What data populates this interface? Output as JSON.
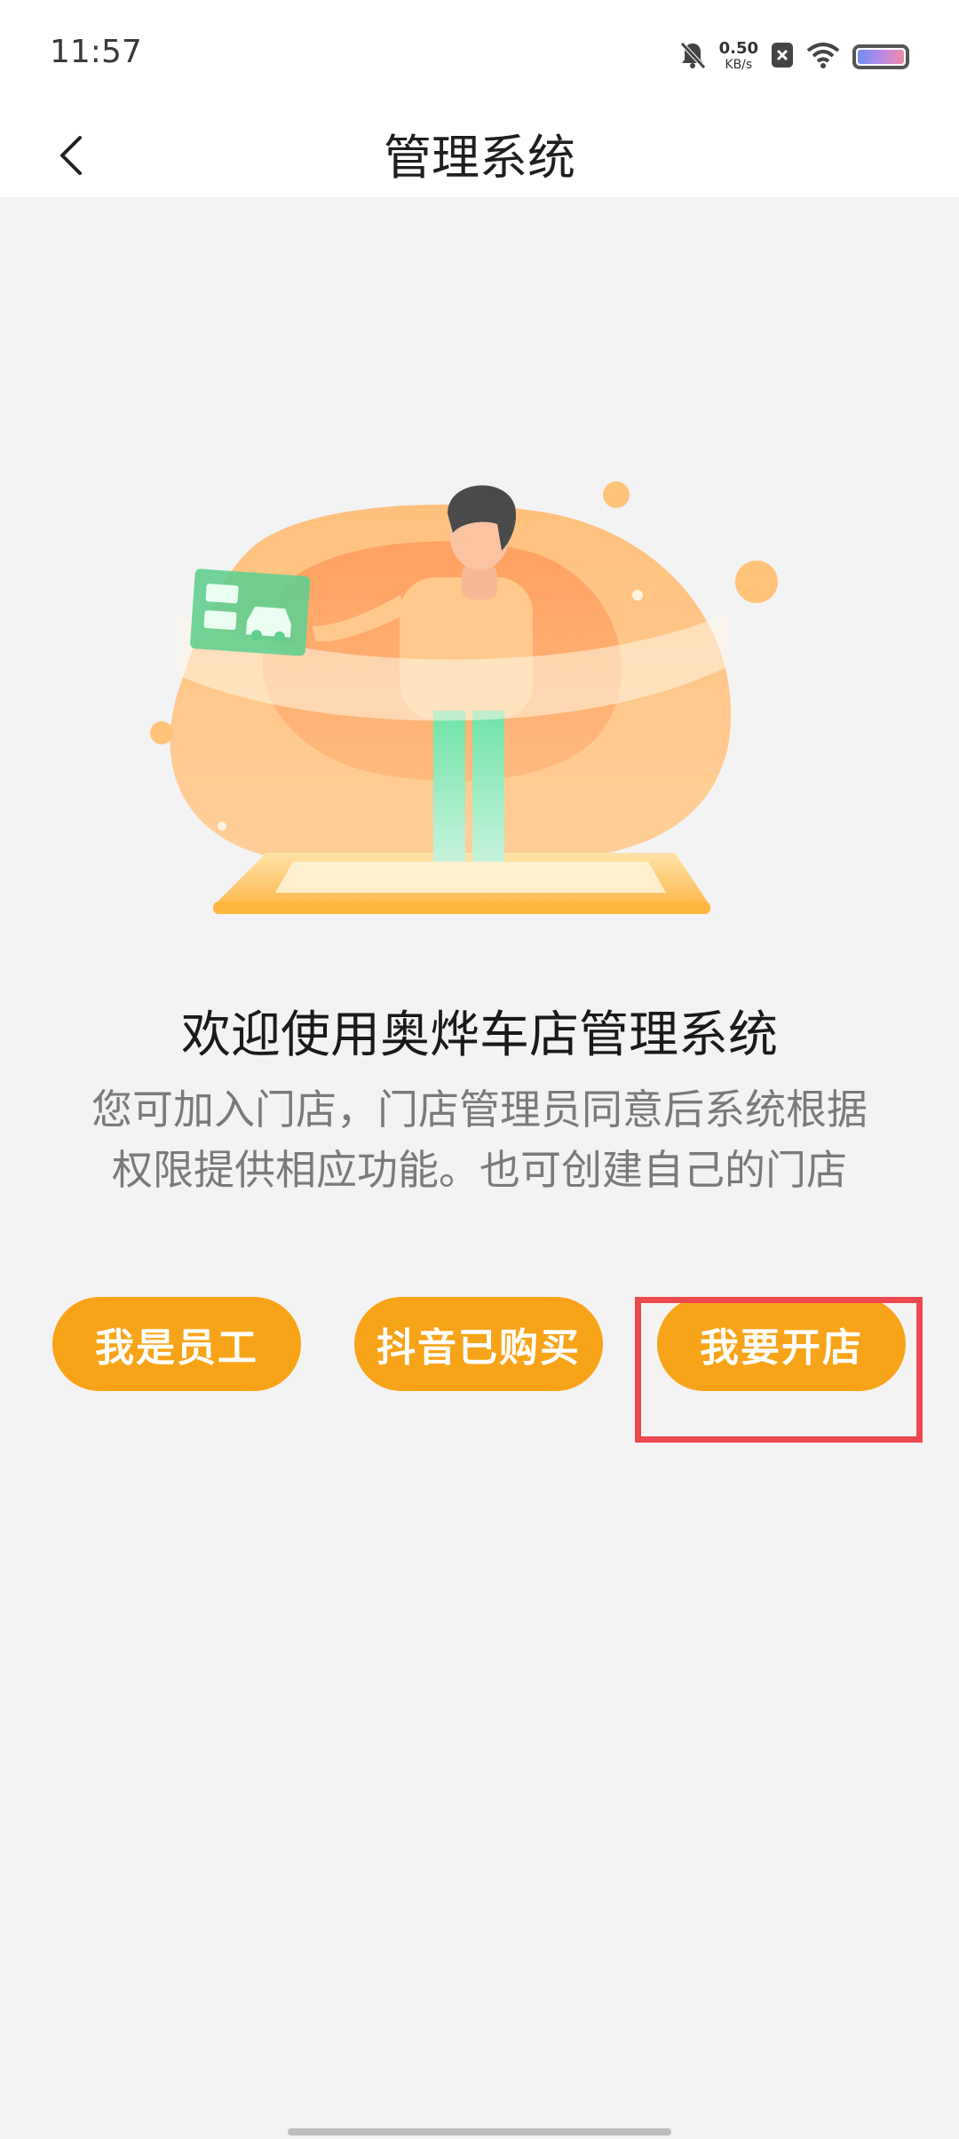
{
  "status_bar": {
    "time": "11:57",
    "net_speed_value": "0.50",
    "net_speed_unit": "KB/s",
    "icons": [
      "bell-off-icon",
      "close-box-icon",
      "wifi-icon",
      "battery-icon"
    ]
  },
  "app_bar": {
    "title": "管理系统",
    "back_icon": "chevron-left-icon"
  },
  "welcome": {
    "title": "欢迎使用奥烨车店管理系统",
    "description_line1": "您可加入门店，门店管理员同意后系统根据",
    "description_line2": "权限提供相应功能。也可创建自己的门店"
  },
  "actions": {
    "employee_label": "我是员工",
    "douyin_label": "抖音已购买",
    "open_store_label": "我要开店"
  },
  "colors": {
    "accent": "#f8a419",
    "highlight": "#ec4a4f",
    "background": "#f4f3f4"
  }
}
